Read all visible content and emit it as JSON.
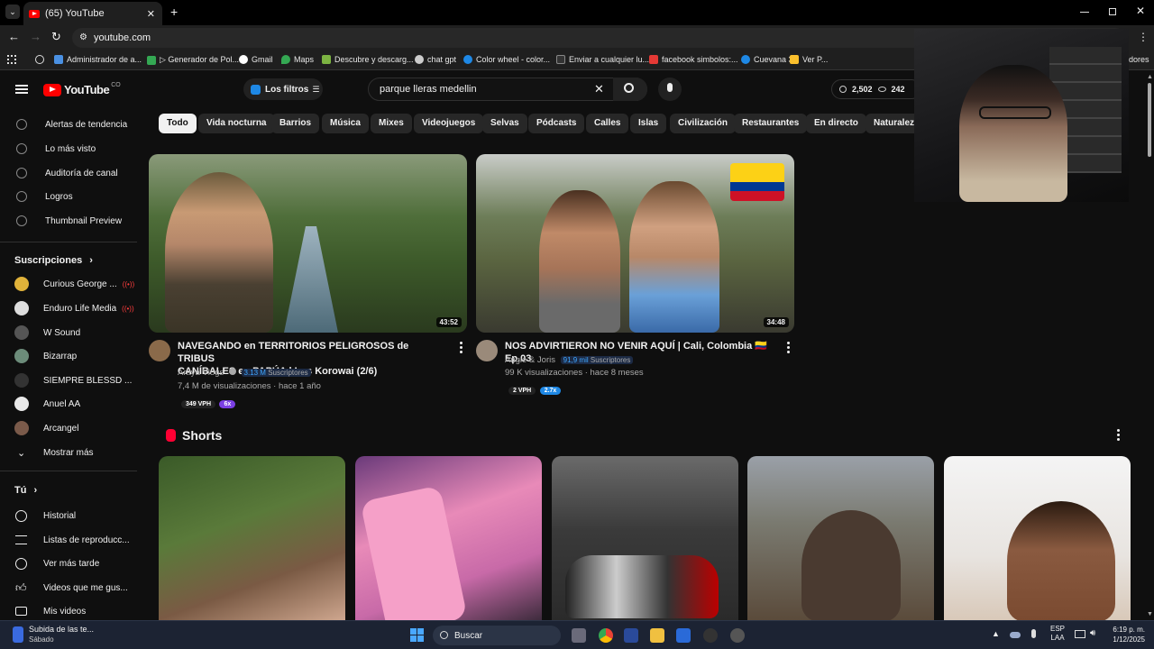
{
  "browser": {
    "tab_title": "(65) YouTube",
    "url": "youtube.com",
    "bookmarks": [
      {
        "label": "Administrador de a...",
        "color": "#4a90e2"
      },
      {
        "label": "▷ Generador de Pol...",
        "color": "#34a853"
      },
      {
        "label": "Gmail",
        "color": "#ea4335"
      },
      {
        "label": "Maps",
        "color": "#34a853"
      },
      {
        "label": "Descubre y descarg...",
        "color": "#7cb342"
      },
      {
        "label": "chat gpt",
        "color": "#cccccc"
      },
      {
        "label": "Color wheel - color...",
        "color": "#1e88e5"
      },
      {
        "label": "Enviar a cualquier lu...",
        "color": "#333333"
      },
      {
        "label": "facebook simbolos:...",
        "color": "#e53935"
      },
      {
        "label": "Cuevana 3",
        "color": "#1e88e5"
      },
      {
        "label": "Ver P...",
        "color": "#fbc02d"
      },
      {
        "label": "dores",
        "color": "#1f1f1f"
      }
    ]
  },
  "header": {
    "logo_text": "YouTube",
    "logo_country": "CO",
    "filters_label": "Los filtros",
    "search_value": "parque lleras medellin",
    "stats": [
      "2,502",
      "242"
    ]
  },
  "sidebar": {
    "top_items": [
      {
        "label": "Alertas de tendencia"
      },
      {
        "label": "Lo más visto"
      },
      {
        "label": "Auditoría de canal"
      },
      {
        "label": "Logros"
      },
      {
        "label": "Thumbnail Preview"
      }
    ],
    "subs_title": "Suscripciones",
    "subscriptions": [
      {
        "label": "Curious George ...",
        "live": "((•))",
        "color": "#e0b23a"
      },
      {
        "label": "Enduro Life Media",
        "live": "((•))",
        "color": "#dddddd"
      },
      {
        "label": "W Sound",
        "live": "",
        "color": "#555555"
      },
      {
        "label": "Bizarrap",
        "live": "",
        "color": "#6c8c7a"
      },
      {
        "label": "SIEMPRE BLESSD ...",
        "live": "",
        "color": "#333333"
      },
      {
        "label": "Anuel AA",
        "live": "",
        "color": "#e8e8e8"
      },
      {
        "label": "Arcangel",
        "live": "",
        "color": "#7a5a4a"
      }
    ],
    "show_more": "Mostrar más",
    "you_title": "Tú",
    "you_items": [
      {
        "label": "Historial"
      },
      {
        "label": "Listas de reproducc..."
      },
      {
        "label": "Ver más tarde"
      },
      {
        "label": "Videos que me gus..."
      },
      {
        "label": "Mis videos"
      }
    ]
  },
  "chips": [
    "Todo",
    "Vida nocturna",
    "Barrios",
    "Música",
    "Mixes",
    "Videojuegos",
    "Selvas",
    "Pódcasts",
    "Calles",
    "Islas",
    "Civilización",
    "Restaurantes",
    "En directo",
    "Naturaleza"
  ],
  "videos": [
    {
      "title_line1": "NAVEGANDO en TERRITORIOS PELIGROSOS de TRIBUS",
      "title_line2": "CANÍBALES en PAPÚA | Los Korowai (2/6)",
      "duration": "43:52",
      "channel": "Araya Vlogs",
      "subs": "3.13 M",
      "subs_word": "Suscriptores",
      "meta": "7,4 M de visualizaciones · hace 1 año",
      "vph": "349 VPH",
      "multiplier": "6x",
      "multiplier_color": "#7b3fe4"
    },
    {
      "title_line1": "NOS ADVIRTIERON NO VENIR AQUÍ | Cali, Colombia 🇨🇴 Ep.03",
      "title_line2": "",
      "duration": "34:48",
      "channel": "Angie & Joris",
      "subs": "91,9 mil",
      "subs_word": "Suscriptores",
      "meta": "99 K visualizaciones · hace 8 meses",
      "vph": "2 VPH",
      "multiplier": "2.7x",
      "multiplier_color": "#1e88e5"
    }
  ],
  "shorts_title": "Shorts",
  "taskbar": {
    "upload_title": "Subida de las te...",
    "upload_sub": "Sábado",
    "search_label": "Buscar",
    "lang": "ESP",
    "lang2": "LAA",
    "time": "6:19 p. m.",
    "date": "1/12/2025"
  }
}
